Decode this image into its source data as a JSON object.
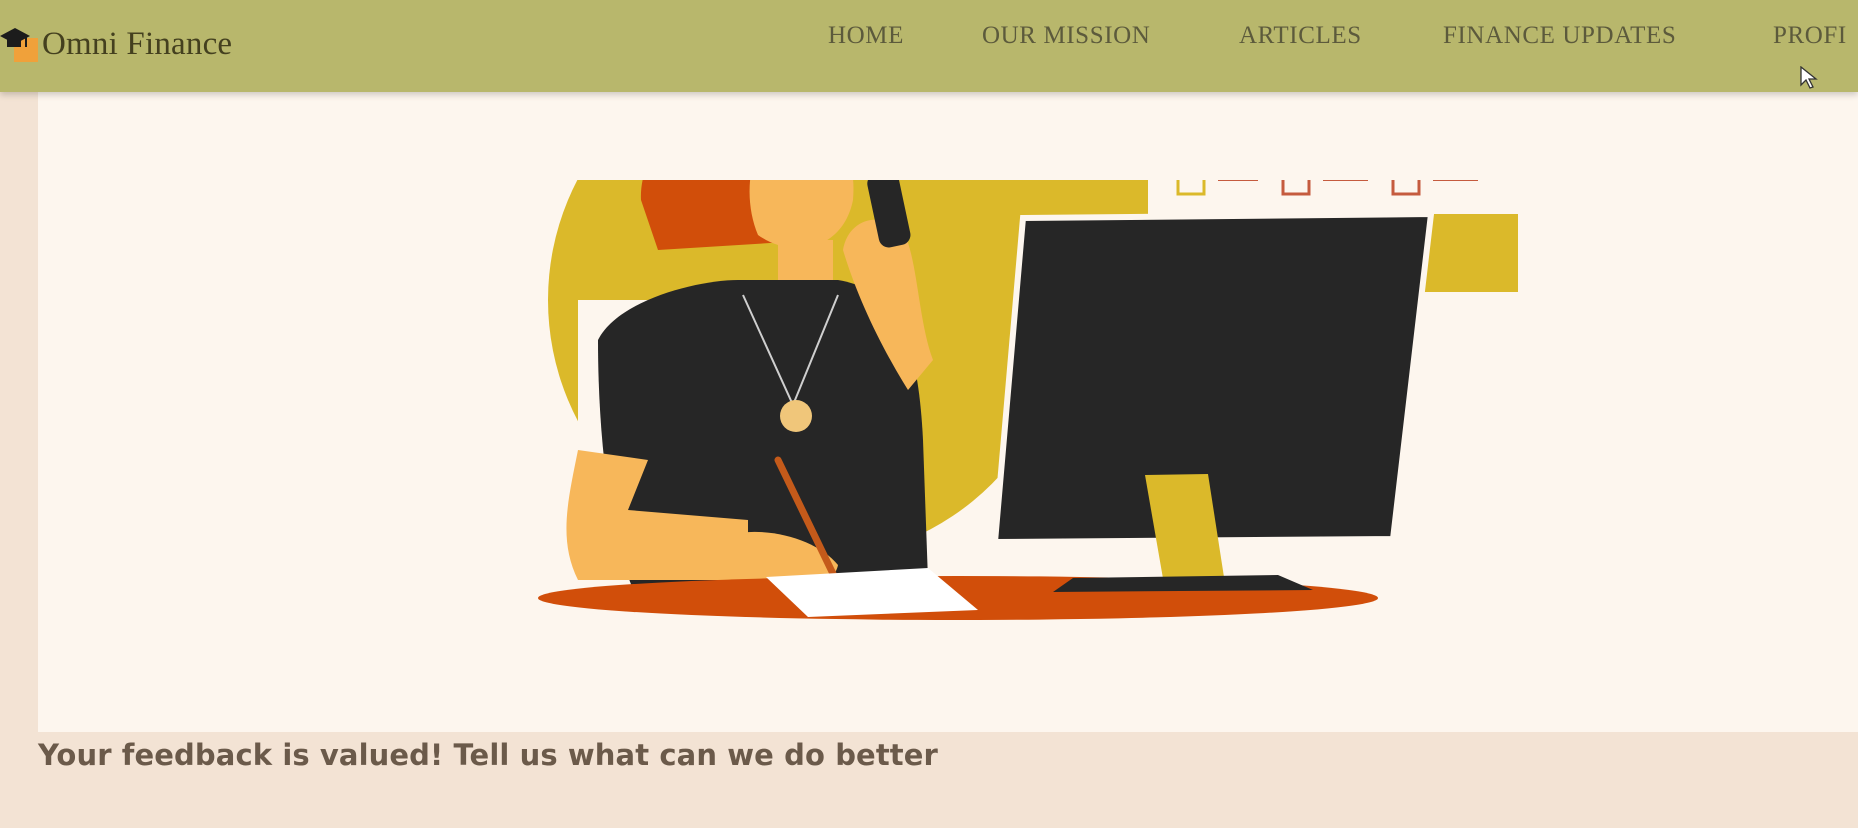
{
  "header": {
    "brand": "Omni Finance",
    "logo_icon": "graduation-cap-icon",
    "nav": [
      {
        "label": "HOME"
      },
      {
        "label": "OUR MISSION"
      },
      {
        "label": "ARTICLES"
      },
      {
        "label": "FINANCE UPDATES"
      },
      {
        "label": "PROFI"
      }
    ]
  },
  "main": {
    "illustration": "woman-on-phone-at-computer-illustration",
    "feedback_text": "Your feedback is valued! Tell us what can we do better"
  },
  "colors": {
    "navbar": "#b8b76c",
    "page_background": "#f3e3d4",
    "panel_background": "#fdf6ee",
    "accent_orange": "#d14e0a",
    "accent_yellow": "#dbb92a",
    "monitor": "#262626"
  }
}
